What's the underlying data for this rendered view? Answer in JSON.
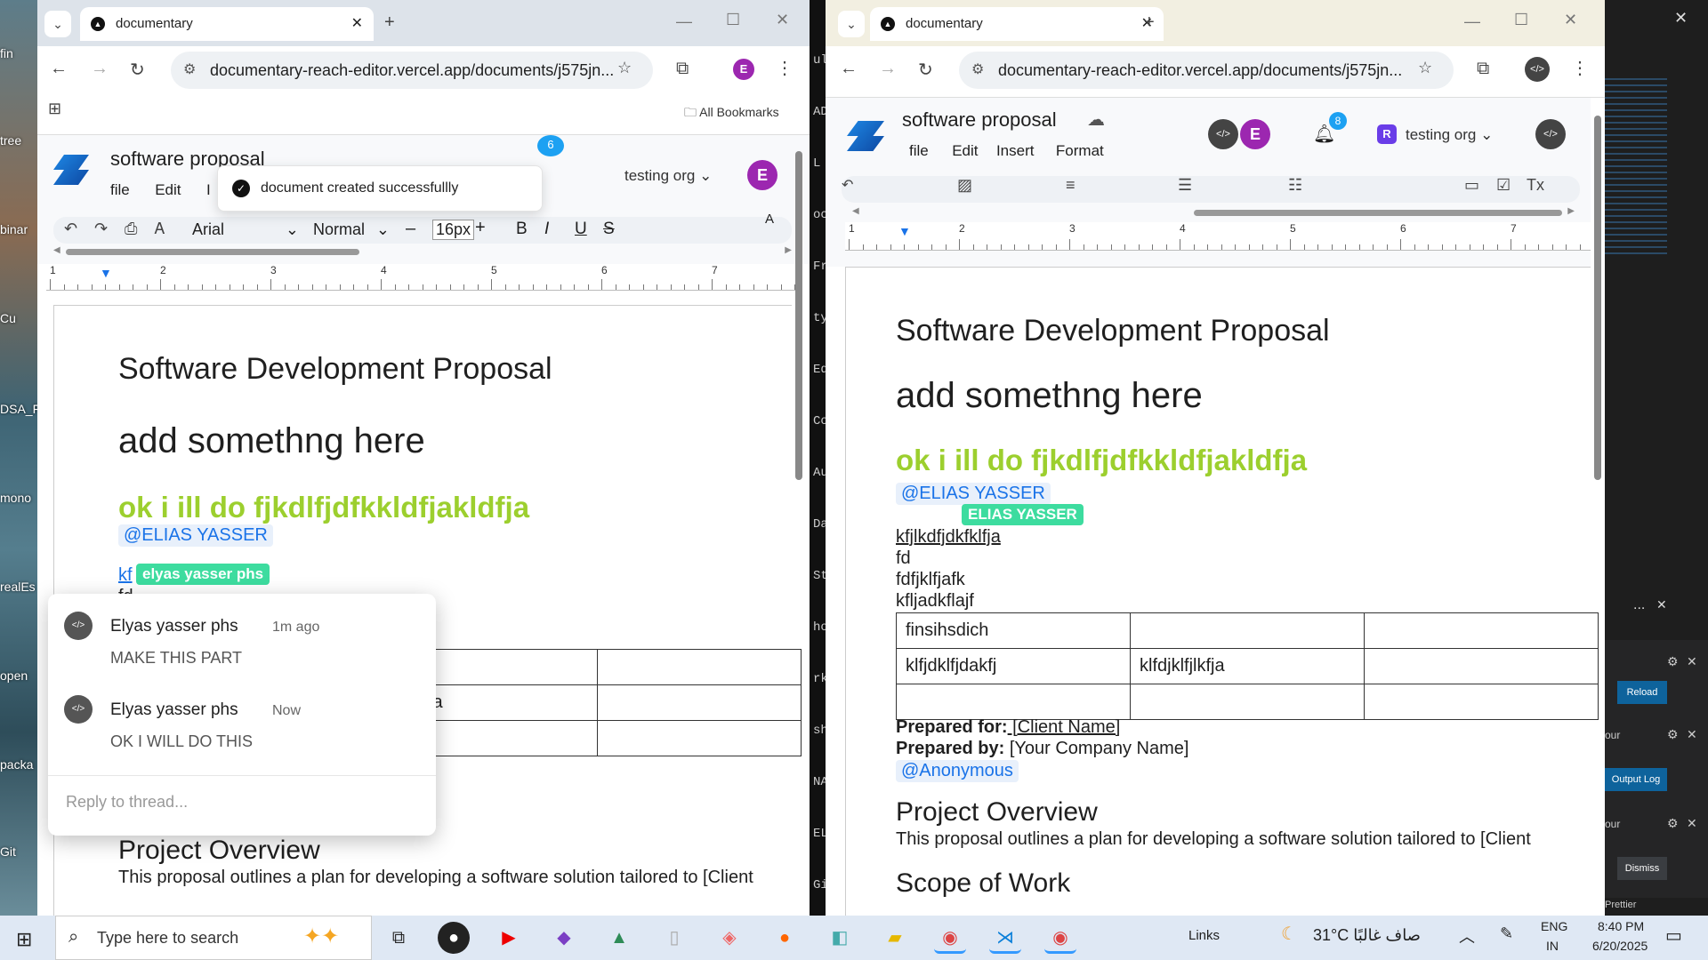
{
  "desktop": {
    "left_icons": [
      "fin",
      "tree",
      "binar",
      "Cu",
      "DSA_F",
      "mono",
      "realEs",
      "open",
      "packa",
      "Git"
    ]
  },
  "left_browser": {
    "tab_title": "documentary",
    "url": "documentary-reach-editor.vercel.app/documents/j575jn...",
    "bookmarks_label": "All Bookmarks",
    "profile_initial": "E",
    "doc_title": "software proposal",
    "menu": [
      "file",
      "Edit",
      "I"
    ],
    "org": "testing org",
    "notif_count": "6",
    "toast": "document created successfullly",
    "toolbar": {
      "font": "Arial",
      "style": "Normal",
      "size": "16px",
      "bold": "B",
      "italic": "I",
      "underline": "U",
      "strike": "S",
      "minus": "–",
      "plus": "+"
    },
    "ruler_nums": [
      "1",
      "2",
      "3",
      "4",
      "5",
      "6",
      "7"
    ],
    "heading": "Software Development Proposal",
    "subheading": "add  somethng here",
    "green_line": "ok i ill do fjkdlfjdfkkldfjakldfja",
    "mention": "@ELIAS YASSER",
    "cursor_text": "kf",
    "cursor_label": "elyas yasser phs",
    "partial_line": "fd",
    "table_partial_cell": "fjlkfja",
    "project_overview": "Project Overview",
    "overview_text": "This proposal outlines a plan for developing a software solution tailored to [Client",
    "thread": {
      "comments": [
        {
          "author": "Elyas yasser phs",
          "time": "1m ago",
          "text": "MAKE THIS PART"
        },
        {
          "author": "Elyas yasser phs",
          "time": "Now",
          "text": "OK I WILL DO THIS"
        }
      ],
      "reply_placeholder": "Reply to thread..."
    }
  },
  "middle_strip": {
    "lines": [
      "ulen",
      "ADM",
      "L",
      "oc",
      "Fr",
      "ty",
      "Ed",
      "Co",
      "Au",
      "Da",
      "St",
      "ho",
      "rk",
      "sh",
      "NAL",
      "ELI",
      "Git"
    ]
  },
  "right_browser": {
    "tab_title": "documentary",
    "url": "documentary-reach-editor.vercel.app/documents/j575jn...",
    "doc_title": "software proposal",
    "menu": [
      "file",
      "Edit",
      "Insert",
      "Format"
    ],
    "profile_initial": "E",
    "notif_count": "8",
    "org_initial": "R",
    "org": "testing org",
    "ruler_nums": [
      "1",
      "2",
      "3",
      "4",
      "5",
      "6",
      "7"
    ],
    "heading": "Software Development Proposal",
    "subheading": "add  somethng here",
    "green_line": "ok i ill do fjkdlfjdfkkldfjakldfja",
    "mention": "@ELIAS YASSER",
    "cursor_label": "ELIAS YASSER",
    "lines": [
      "kfjlkdfjdkfklfja",
      "fd",
      "fdfjklfjafk",
      "kfljadkflajf"
    ],
    "table": [
      [
        "finsihsdich",
        "",
        ""
      ],
      [
        "klfjdklfjdakfj",
        "klfdjklfjlkfja",
        ""
      ],
      [
        "",
        "",
        ""
      ]
    ],
    "prepared_for_label": "Prepared for:",
    "prepared_for_value": " [Client Name]",
    "prepared_by_label": "Prepared by:",
    "prepared_by_value": " [Your Company Name]",
    "mention2": "@Anonymous",
    "project_overview": "Project Overview",
    "overview_text": "This proposal outlines a plan for developing a software solution tailored to [Client",
    "scope": "Scope of Work"
  },
  "right_panel": {
    "reload": "Reload",
    "output_log": "Output Log",
    "dismiss": "Dismiss",
    "ellipsis": "...",
    "our1": "our",
    "our2": "our",
    "prettier": "Prettier"
  },
  "taskbar": {
    "search_placeholder": "Type here to search",
    "links": "Links",
    "weather": "31°C  صاف غالبًا",
    "lang_1": "ENG",
    "lang_2": "IN",
    "time": "8:40 PM",
    "date": "6/20/2025"
  },
  "colors": {
    "accent": "#1a73e8",
    "green_text": "#9ccf2e",
    "cursor_chip": "#3ddc9f",
    "avatar": "#9c27b0"
  }
}
